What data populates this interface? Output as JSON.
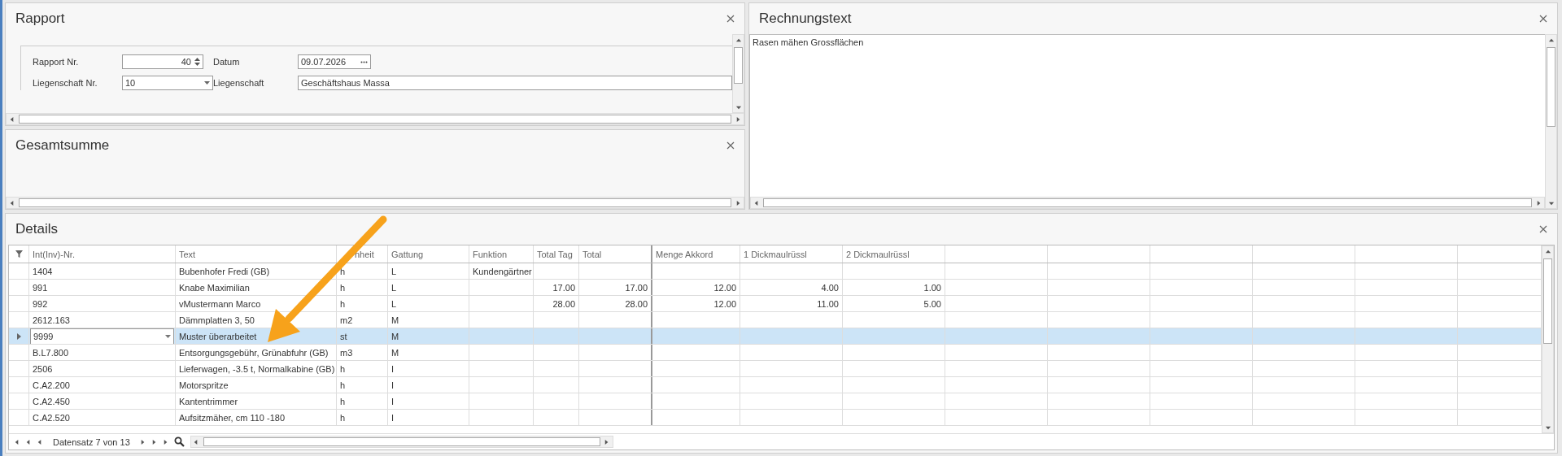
{
  "rapport": {
    "title": "Rapport",
    "fields": [
      {
        "label": "Rapport Nr.",
        "value": "40",
        "kind": "spin"
      },
      {
        "label": "Datum",
        "value": "09.07.2026",
        "kind": "date"
      },
      {
        "label": "Liegenschaft Nr.",
        "value": "10",
        "kind": "combo"
      },
      {
        "label": "Liegenschaft",
        "value": "Geschäftshaus Massa",
        "kind": "text"
      }
    ]
  },
  "gesamtsumme": {
    "title": "Gesamtsumme"
  },
  "rechnungstext": {
    "title": "Rechnungstext",
    "value": "Rasen mähen Grossflächen"
  },
  "details": {
    "title": "Details",
    "columns": [
      {
        "label": "Int(Inv)-Nr.",
        "kind": "text"
      },
      {
        "label": "Text",
        "kind": "text"
      },
      {
        "label": "nheit",
        "kind": "text"
      },
      {
        "label": "Gattung",
        "kind": "text"
      },
      {
        "label": "Funktion",
        "kind": "text"
      },
      {
        "label": "Total Tag",
        "kind": "number"
      },
      {
        "label": "Total",
        "kind": "number"
      },
      {
        "label": "Menge Akkord",
        "kind": "number"
      },
      {
        "label": "1 Dickmaulrüssl",
        "kind": "number"
      },
      {
        "label": "2 Dickmaulrüssl",
        "kind": "number"
      }
    ],
    "rows": [
      {
        "selected": false,
        "cells": [
          "1404",
          "Bubenhofer Fredi (GB)",
          "h",
          "L",
          "Kundengärtner",
          null,
          null,
          null,
          null,
          null
        ]
      },
      {
        "selected": false,
        "cells": [
          "991",
          "Knabe Maximilian",
          "h",
          "L",
          null,
          "17.00",
          "17.00",
          "12.00",
          "4.00",
          "1.00"
        ]
      },
      {
        "selected": false,
        "cells": [
          "992",
          "vMustermann Marco",
          "h",
          "L",
          null,
          "28.00",
          "28.00",
          "12.00",
          "11.00",
          "5.00"
        ]
      },
      {
        "selected": false,
        "cells": [
          "2612.163",
          "Dämmplatten 3, 50",
          "m2",
          "M",
          null,
          null,
          null,
          null,
          null,
          null
        ]
      },
      {
        "selected": true,
        "cells": [
          "9999",
          "Muster überarbeitet",
          "st",
          "M",
          null,
          null,
          null,
          null,
          null,
          null
        ]
      },
      {
        "selected": false,
        "cells": [
          "B.L7.800",
          "Entsorgungsgebühr, Grünabfuhr (GB)",
          "m3",
          "M",
          null,
          null,
          null,
          null,
          null,
          null
        ]
      },
      {
        "selected": false,
        "cells": [
          "2506",
          "Lieferwagen, -3.5 t, Normalkabine (GB)",
          "h",
          "I",
          null,
          null,
          null,
          null,
          null,
          null
        ]
      },
      {
        "selected": false,
        "cells": [
          "C.A2.200",
          "Motorspritze",
          "h",
          "I",
          null,
          null,
          null,
          null,
          null,
          null
        ]
      },
      {
        "selected": false,
        "cells": [
          "C.A2.450",
          "Kantentrimmer",
          "h",
          "I",
          null,
          null,
          null,
          null,
          null,
          null
        ]
      },
      {
        "selected": false,
        "cells": [
          "C.A2.520",
          "Aufsitzmäher, cm 110 -180",
          "h",
          "I",
          null,
          null,
          null,
          null,
          null,
          null
        ]
      }
    ],
    "pager": "Datensatz 7 von 13"
  }
}
